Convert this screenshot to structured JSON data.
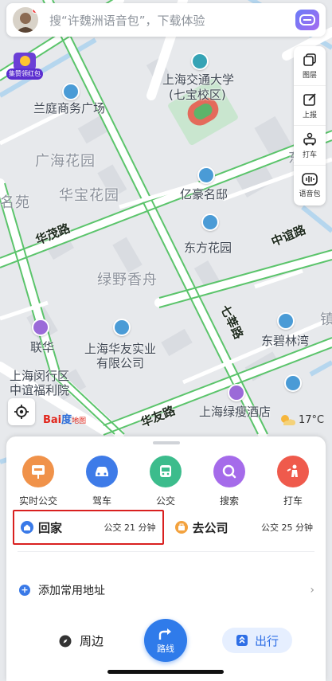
{
  "search": {
    "placeholder": "搜“许魏洲语音包”，下载体验"
  },
  "promo": {
    "label": "集赞领红包"
  },
  "tools": [
    {
      "label": "图层",
      "icon": "layers-icon"
    },
    {
      "label": "上报",
      "icon": "report-icon"
    },
    {
      "label": "打车",
      "icon": "taxi-icon"
    },
    {
      "label": "语音包",
      "icon": "voice-pack-icon"
    }
  ],
  "map": {
    "labels": {
      "sjtu": "上海交通大学",
      "sjtu_sub": "(七宝校区)",
      "lanting": "兰庭商务广场",
      "guanghai": "广海花园",
      "huabao": "华宝花园",
      "yihao": "亿豪名邸",
      "ming": "名苑",
      "huamao": "华茂路",
      "zhongyi": "中谊路",
      "dongfang": "东方花园",
      "lvye": "绿野香舟",
      "qixin": "七莘路",
      "dongbi": "东碧林湾",
      "lianhua": "联华",
      "huayou1": "上海华友实业",
      "huayou2": "有限公司",
      "minhang1": "上海闵行区",
      "minhang2": "中谊福利院",
      "huayoulu": "华友路",
      "lvshou": "上海绿瘦酒店",
      "dong": "东",
      "zhen": "镇"
    }
  },
  "baidu": {
    "bai": "Bai",
    "du": "度",
    "map": "地图"
  },
  "weather": {
    "temp": "17°C"
  },
  "quick": [
    {
      "label": "实时公交",
      "color": "#f0924a",
      "icon": "bus-stop-icon"
    },
    {
      "label": "驾车",
      "color": "#3e7be8",
      "icon": "car-icon"
    },
    {
      "label": "公交",
      "color": "#3cbc8c",
      "icon": "bus-icon"
    },
    {
      "label": "搜索",
      "color": "#a56bea",
      "icon": "search-icon"
    },
    {
      "label": "打车",
      "color": "#ef5a4c",
      "icon": "taxi-person-icon"
    }
  ],
  "home": {
    "label": "回家",
    "time": "公交 21 分钟"
  },
  "work": {
    "label": "去公司",
    "time": "公交 25 分钟"
  },
  "add_address": {
    "label": "添加常用地址"
  },
  "bottom": {
    "nearby": "周边",
    "route": "路线",
    "go": "出行"
  }
}
